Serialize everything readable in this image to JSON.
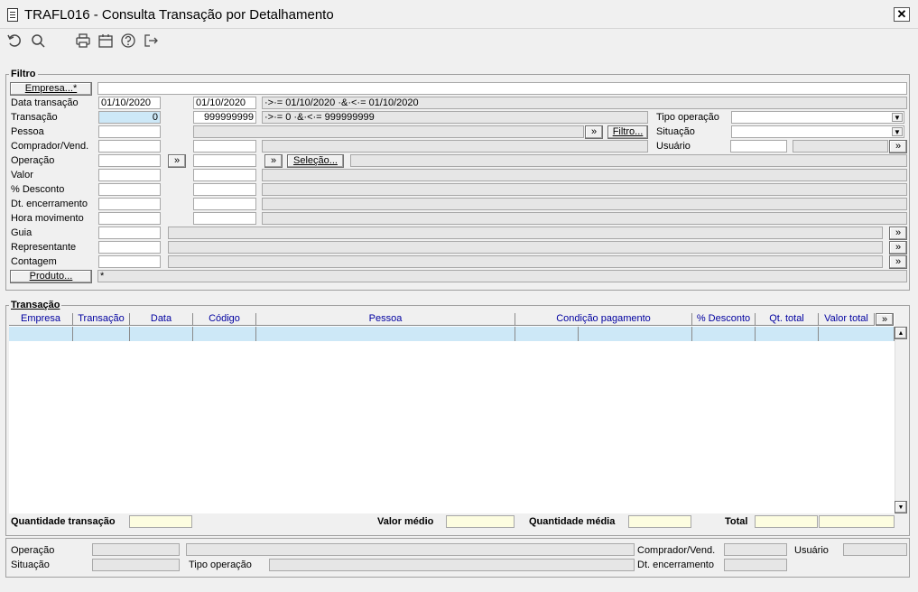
{
  "window": {
    "title": "TRAFL016 - Consulta Transação por Detalhamento",
    "close_label": "✕"
  },
  "toolbar": {
    "icons": [
      "undo-icon",
      "search-icon",
      "print-icon",
      "calendar-icon",
      "help-icon",
      "exit-icon"
    ]
  },
  "filtro": {
    "title": "Filtro",
    "empresa_label": "Empresa...*",
    "data_transacao_label": "Data transação",
    "data_de": "01/10/2020",
    "data_ate": "01/10/2020",
    "data_desc": "·>·= 01/10/2020 ·&·<·= 01/10/2020",
    "transacao_label": "Transação",
    "transacao_de": "0",
    "transacao_ate": "999999999",
    "transacao_desc": "·>·= 0 ·&·<·= 999999999",
    "pessoa_label": "Pessoa",
    "comprador_label": "Comprador/Vend.",
    "operacao_label": "Operação",
    "valor_label": "Valor",
    "desconto_label": "% Desconto",
    "dt_encerramento_label": "Dt. encerramento",
    "hora_movimento_label": "Hora movimento",
    "guia_label": "Guia",
    "representante_label": "Representante",
    "contagem_label": "Contagem",
    "produto_label": "Produto...",
    "produto_value": "*",
    "tipo_operacao_label": "Tipo operação",
    "situacao_label": "Situação",
    "usuario_label": "Usuário",
    "filtro_button": "Filtro...",
    "selecao_button": "Seleção...",
    "arrow": "»"
  },
  "transacao": {
    "title": "Transação",
    "columns": [
      "Empresa",
      "Transação",
      "Data",
      "Código",
      "Pessoa",
      "Condição pagamento",
      "% Desconto",
      "Qt. total",
      "Valor total"
    ],
    "more": "»"
  },
  "totals": {
    "quantidade_transacao": "Quantidade transação",
    "valor_medio": "Valor médio",
    "quantidade_media": "Quantidade média",
    "total": "Total"
  },
  "footer": {
    "operacao": "Operação",
    "situacao": "Situação",
    "tipo_operacao": "Tipo operação",
    "comprador": "Comprador/Vend.",
    "dt_encerramento": "Dt. encerramento",
    "usuario": "Usuário"
  }
}
